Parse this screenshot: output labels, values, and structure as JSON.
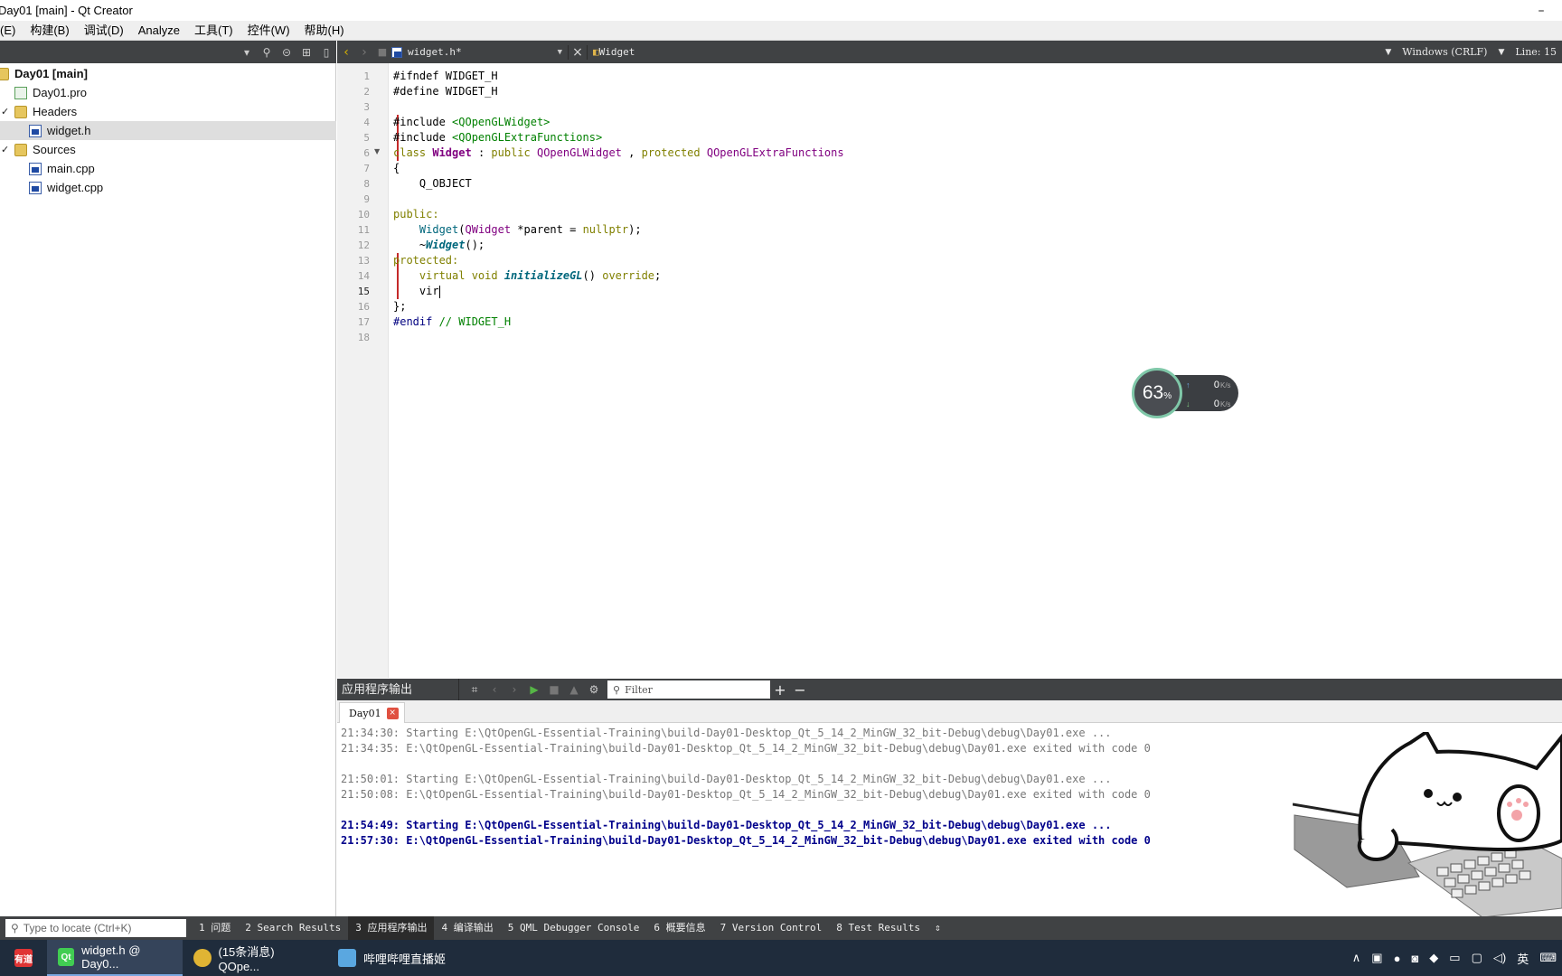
{
  "window": {
    "title": "Day01 [main] - Qt Creator",
    "close_glyph": "–"
  },
  "menubar": {
    "items": [
      "(E)",
      "构建(B)",
      "调试(D)",
      "Analyze",
      "工具(T)",
      "控件(W)",
      "帮助(H)"
    ]
  },
  "project_tree": {
    "items": [
      {
        "label": "Day01 [main]",
        "icon": "project-folder-icon"
      },
      {
        "label": "Day01.pro",
        "icon": "pro-file-icon"
      },
      {
        "label": "Headers",
        "icon": "folder-icon"
      },
      {
        "label": "widget.h",
        "icon": "header-file-icon",
        "selected": true
      },
      {
        "label": "Sources",
        "icon": "folder-icon"
      },
      {
        "label": "main.cpp",
        "icon": "cpp-file-icon"
      },
      {
        "label": "widget.cpp",
        "icon": "cpp-file-icon"
      }
    ]
  },
  "editor_toolbar": {
    "file_name": "widget.h*",
    "symbol": "Widget",
    "line_ending": "Windows (CRLF)",
    "line_info": "Line: 15"
  },
  "editor": {
    "line_numbers": [
      "1",
      "2",
      "3",
      "4",
      "5",
      "6",
      "7",
      "8",
      "9",
      "10",
      "11",
      "12",
      "13",
      "14",
      "15",
      "16",
      "17",
      "18"
    ],
    "current_line": "15",
    "code": {
      "l1": "#ifndef WIDGET_H",
      "l2": "#define WIDGET_H",
      "l4a": "#include ",
      "l4b": "<QOpenGLWidget>",
      "l5a": "#include ",
      "l5b": "<QOpenGLExtraFunctions>",
      "l6a": "class ",
      "l6b": "Widget",
      "l6c": " : ",
      "l6d": "public ",
      "l6e": "QOpenGLWidget",
      "l6f": " , ",
      "l6g": "protected ",
      "l6h": "QOpenGLExtraFunctions",
      "l7": "{",
      "l8": "    Q_OBJECT",
      "l10": "public:",
      "l11a": "    ",
      "l11b": "Widget",
      "l11c": "(",
      "l11d": "QWidget",
      "l11e": " *parent = ",
      "l11f": "nullptr",
      "l11g": ");",
      "l12a": "    ~",
      "l12b": "Widget",
      "l12c": "();",
      "l13": "protected:",
      "l14a": "    ",
      "l14b": "virtual void ",
      "l14c": "initializeGL",
      "l14d": "() ",
      "l14e": "override",
      "l14f": ";",
      "l15": "    vir",
      "l16": "};",
      "l17a": "#endif ",
      "l17b": "// WIDGET_H"
    }
  },
  "speed_widget": {
    "percent": "63",
    "percent_sign": "%",
    "upload": "0",
    "download": "0",
    "unit": "K/s"
  },
  "output_pane": {
    "title": "应用程序输出",
    "filter_placeholder": "Filter",
    "tab": "Day01",
    "lines": [
      "21:34:30: Starting E:\\QtOpenGL-Essential-Training\\build-Day01-Desktop_Qt_5_14_2_MinGW_32_bit-Debug\\debug\\Day01.exe ...",
      "21:34:35: E:\\QtOpenGL-Essential-Training\\build-Day01-Desktop_Qt_5_14_2_MinGW_32_bit-Debug\\debug\\Day01.exe exited with code 0",
      "21:50:01: Starting E:\\QtOpenGL-Essential-Training\\build-Day01-Desktop_Qt_5_14_2_MinGW_32_bit-Debug\\debug\\Day01.exe ...",
      "21:50:08: E:\\QtOpenGL-Essential-Training\\build-Day01-Desktop_Qt_5_14_2_MinGW_32_bit-Debug\\debug\\Day01.exe exited with code 0",
      "21:54:49: Starting E:\\QtOpenGL-Essential-Training\\build-Day01-Desktop_Qt_5_14_2_MinGW_32_bit-Debug\\debug\\Day01.exe ...",
      "21:57:30: E:\\QtOpenGL-Essential-Training\\build-Day01-Desktop_Qt_5_14_2_MinGW_32_bit-Debug\\debug\\Day01.exe exited with code 0"
    ]
  },
  "statusbar": {
    "locator_placeholder": "Type to locate (Ctrl+K)",
    "tabs": [
      "1 问题",
      "2 Search Results",
      "3 应用程序输出",
      "4 编译输出",
      "5 QML Debugger Console",
      "6 概要信息",
      "7 Version Control",
      "8 Test Results"
    ],
    "active_tab": "3 应用程序输出"
  },
  "taskbar": {
    "apps": [
      {
        "label": "",
        "icon": "youdao-icon",
        "badge": "有道"
      },
      {
        "label": "widget.h @ Day0...",
        "icon": "qt-icon",
        "badge": "Qt",
        "active": true
      },
      {
        "label": "(15条消息) QOpe...",
        "icon": "chrome-icon"
      },
      {
        "label": "哔哩哔哩直播姬",
        "icon": "bilibili-icon"
      }
    ],
    "tray": {
      "lang": "英"
    }
  },
  "colors": {
    "accent_dark": "#404244",
    "keyword": "#808000",
    "type": "#800080",
    "string": "#008000",
    "output_bold": "#00008b"
  }
}
